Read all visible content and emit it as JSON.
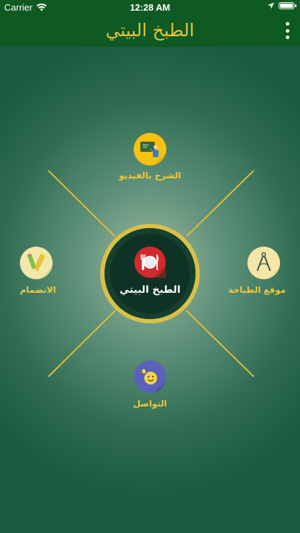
{
  "status_bar": {
    "carrier": "Carrier",
    "time": "12:28 AM",
    "icons": [
      "wifi-icon",
      "location-arrow-icon",
      "battery-icon"
    ]
  },
  "nav": {
    "title": "الطبخ البيتي",
    "menu_icon": "more-vertical-icon"
  },
  "center": {
    "label": "الطبخ البيتي",
    "icon": "plate-cutlery-icon",
    "icon_color": "#d32a2e"
  },
  "nodes": {
    "video": {
      "label": "الشرح بالفيديو",
      "icon": "teacher-board-icon",
      "color": "#f5c20f"
    },
    "site": {
      "label": "موقع الطباخة",
      "icon": "compass-drawing-icon",
      "color": "#f4e7a6"
    },
    "join": {
      "label": "الانضمام",
      "icon": "pencil-ruler-icon",
      "color": "#f1e9a9"
    },
    "contact": {
      "label": "التواصل",
      "icon": "waving-smiley-icon",
      "color": "#5a62b8"
    }
  },
  "colors": {
    "bar": "#0f5a22",
    "title": "#e7c33b",
    "accent_lines": "#e3b93a",
    "label": "#f0c93a"
  }
}
